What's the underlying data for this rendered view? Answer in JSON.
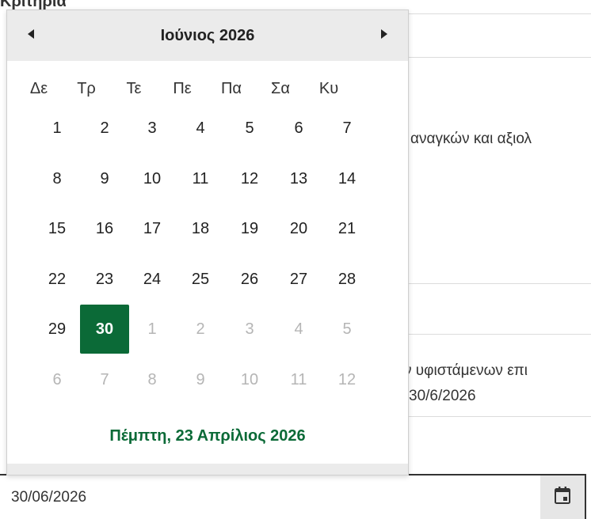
{
  "background": {
    "top_text": "Κριτήρια",
    "line1_text": "αναγκών και αξιολ",
    "line2_text": "ν υφιστάμενων επι",
    "line3_text": "30/6/2026"
  },
  "date_field": {
    "value": "30/06/2026"
  },
  "calendar": {
    "month_title": "Ιούνιος 2026",
    "weekdays": [
      "Δε",
      "Τρ",
      "Τε",
      "Πε",
      "Πα",
      "Σα",
      "Κυ"
    ],
    "weeks": [
      [
        {
          "d": "1",
          "o": false
        },
        {
          "d": "2",
          "o": false
        },
        {
          "d": "3",
          "o": false
        },
        {
          "d": "4",
          "o": false
        },
        {
          "d": "5",
          "o": false
        },
        {
          "d": "6",
          "o": false
        },
        {
          "d": "7",
          "o": false
        }
      ],
      [
        {
          "d": "8",
          "o": false
        },
        {
          "d": "9",
          "o": false
        },
        {
          "d": "10",
          "o": false
        },
        {
          "d": "11",
          "o": false
        },
        {
          "d": "12",
          "o": false
        },
        {
          "d": "13",
          "o": false
        },
        {
          "d": "14",
          "o": false
        }
      ],
      [
        {
          "d": "15",
          "o": false
        },
        {
          "d": "16",
          "o": false
        },
        {
          "d": "17",
          "o": false
        },
        {
          "d": "18",
          "o": false
        },
        {
          "d": "19",
          "o": false
        },
        {
          "d": "20",
          "o": false
        },
        {
          "d": "21",
          "o": false
        }
      ],
      [
        {
          "d": "22",
          "o": false
        },
        {
          "d": "23",
          "o": false
        },
        {
          "d": "24",
          "o": false
        },
        {
          "d": "25",
          "o": false
        },
        {
          "d": "26",
          "o": false
        },
        {
          "d": "27",
          "o": false
        },
        {
          "d": "28",
          "o": false
        }
      ],
      [
        {
          "d": "29",
          "o": false
        },
        {
          "d": "30",
          "o": false,
          "selected": true
        },
        {
          "d": "1",
          "o": true
        },
        {
          "d": "2",
          "o": true
        },
        {
          "d": "3",
          "o": true
        },
        {
          "d": "4",
          "o": true
        },
        {
          "d": "5",
          "o": true
        }
      ],
      [
        {
          "d": "6",
          "o": true
        },
        {
          "d": "7",
          "o": true
        },
        {
          "d": "8",
          "o": true
        },
        {
          "d": "9",
          "o": true
        },
        {
          "d": "10",
          "o": true
        },
        {
          "d": "11",
          "o": true
        },
        {
          "d": "12",
          "o": true
        }
      ]
    ],
    "today_label": "Πέμπτη, 23 Απρίλιος 2026"
  },
  "icons": {
    "prev": "caret-left-icon",
    "next": "caret-right-icon",
    "calendar": "calendar-icon"
  },
  "colors": {
    "accent": "#0b6a37",
    "header_bg": "#ebebeb",
    "muted_day": "#b5b5b5"
  }
}
